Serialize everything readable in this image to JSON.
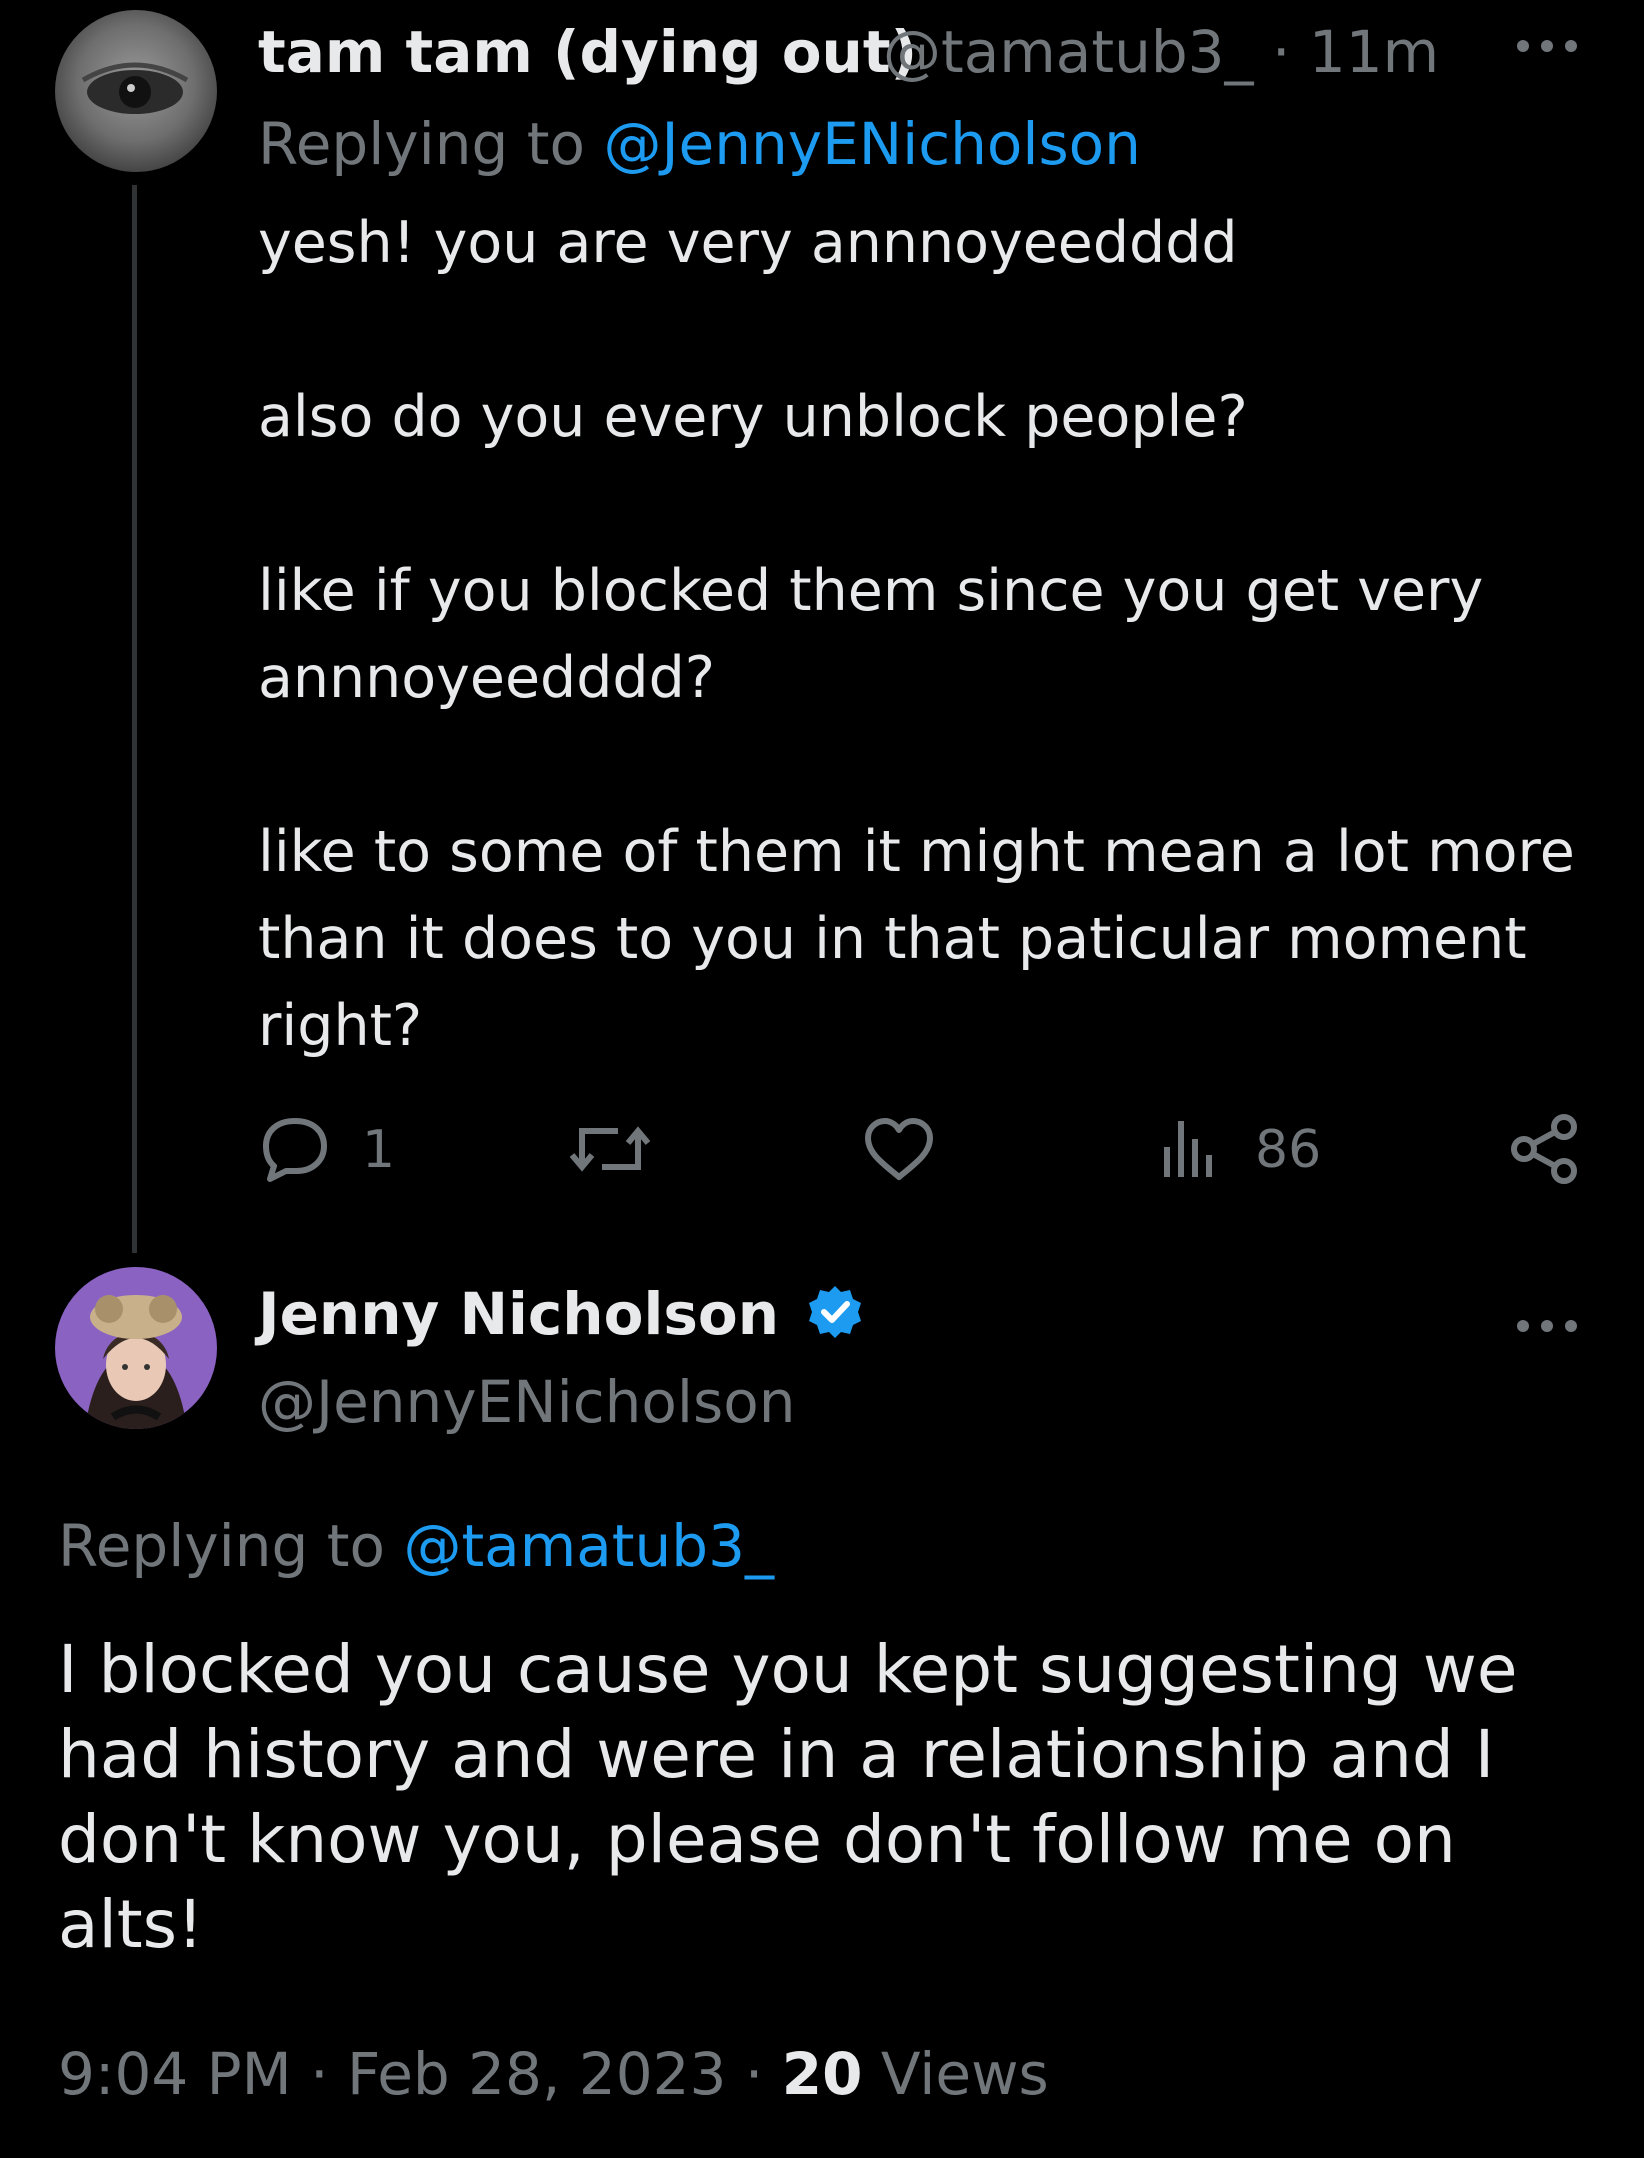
{
  "reply_tweet": {
    "display_name": "tam tam (dying out)",
    "handle": "@tamatub3_",
    "separator": "·",
    "time": "11m",
    "replying_prefix": "Replying to",
    "replying_to": "@JennyENicholson",
    "text": "yesh! you are very annnoyeedddd\n\nalso do you every unblock people?\n\nlike if you blocked them since you get very annnoyeedddd?\n\nlike to some of them it might mean a lot more than it does to you in that paticular moment right?",
    "actions": {
      "reply_count": "1",
      "views_count": "86"
    },
    "icons": [
      "avatar-eye",
      "more-icon",
      "reply-icon",
      "retweet-icon",
      "like-icon",
      "views-icon",
      "share-icon"
    ]
  },
  "main_tweet": {
    "display_name": "Jenny Nicholson",
    "handle": "@JennyENicholson",
    "replying_prefix": "Replying to",
    "replying_to": "@tamatub3_",
    "text": "I blocked you cause you kept suggesting we had history and were in a relationship and I don't know you, please don't follow me on alts!",
    "time": "9:04 PM",
    "date": "Feb 28, 2023",
    "separator": "·",
    "views_count": "20",
    "views_label": "Views",
    "icons": [
      "verified-badge-icon",
      "more-icon"
    ]
  },
  "colors": {
    "background": "#000000",
    "text": "#e7e9ea",
    "muted": "#71767b",
    "link": "#1d9bf0",
    "verified": "#1d9bf0"
  }
}
